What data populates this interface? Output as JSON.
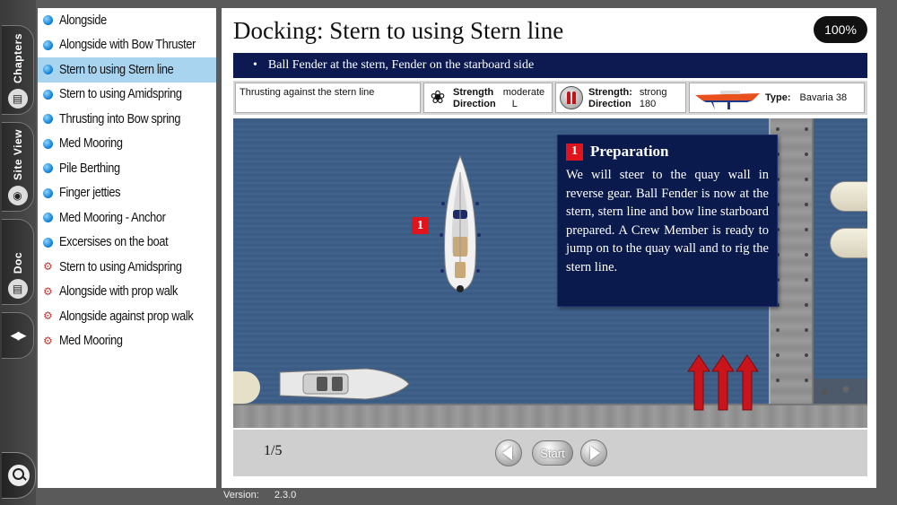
{
  "rail": {
    "tabs": [
      {
        "label": "Chapters",
        "icon": "books-icon"
      },
      {
        "label": "Site View",
        "icon": "globe-icon"
      },
      {
        "label": "Doc",
        "icon": "book-icon"
      }
    ],
    "nav_icon": "prev-next-icon",
    "search_icon": "magnifier-icon"
  },
  "sidebar": {
    "items": [
      {
        "label": "Alongside",
        "marker": "blue-bullet",
        "active": false
      },
      {
        "label": "Alongside with Bow Thruster",
        "marker": "blue-bullet",
        "active": false
      },
      {
        "label": "Stern to using Stern line",
        "marker": "blue-bullet",
        "active": true
      },
      {
        "label": "Stern to using Amidspring",
        "marker": "blue-bullet",
        "active": false
      },
      {
        "label": "Thrusting into Bow spring",
        "marker": "blue-bullet",
        "active": false
      },
      {
        "label": "Med Mooring",
        "marker": "blue-bullet",
        "active": false
      },
      {
        "label": "Pile Berthing",
        "marker": "blue-bullet",
        "active": false
      },
      {
        "label": "Finger jetties",
        "marker": "blue-bullet",
        "active": false
      },
      {
        "label": "Med Mooring - Anchor",
        "marker": "blue-bullet",
        "active": false
      },
      {
        "label": "Excersises on the boat",
        "marker": "blue-bullet",
        "active": false
      },
      {
        "label": "Stern to using Amidspring",
        "marker": "red-gear",
        "active": false
      },
      {
        "label": "Alongside with prop walk",
        "marker": "red-gear",
        "active": false
      },
      {
        "label": "Alongside against prop walk",
        "marker": "red-gear",
        "active": false
      },
      {
        "label": "Med Mooring",
        "marker": "red-gear",
        "active": false
      }
    ]
  },
  "main": {
    "title": "Docking: Stern to using Stern line",
    "zoom": "100%",
    "banner": "Ball Fender at the stern, Fender on the starboard side",
    "info": {
      "note": "Thrusting against the stern line",
      "prop": {
        "strength_label": "Strength",
        "strength_value": "moderate",
        "direction_label": "Direction",
        "direction_value": "L"
      },
      "wind": {
        "strength_label": "Strength:",
        "strength_value": "strong",
        "direction_label": "Direction",
        "direction_value": "180"
      },
      "boat": {
        "type_label": "Type:",
        "type_value": "Bavaria 38"
      }
    },
    "scene": {
      "boat_badge": "1",
      "step_box": {
        "number": "1",
        "title": "Preparation",
        "text": "We will steer to the quay wall in reverse gear. Ball Fender is now at the stern, stern line and bow line starboard prepared. A Crew Member is ready to jump on to the quay wall and to rig the stern line."
      }
    },
    "footer": {
      "page": "1/5",
      "start_label": "Start"
    }
  },
  "version": {
    "label": "Version:",
    "value": "2.3.0"
  },
  "colors": {
    "banner": "#0d1a52",
    "active_item": "#a8d4f0",
    "water": "#3a5a82",
    "badge": "#e0141a"
  }
}
